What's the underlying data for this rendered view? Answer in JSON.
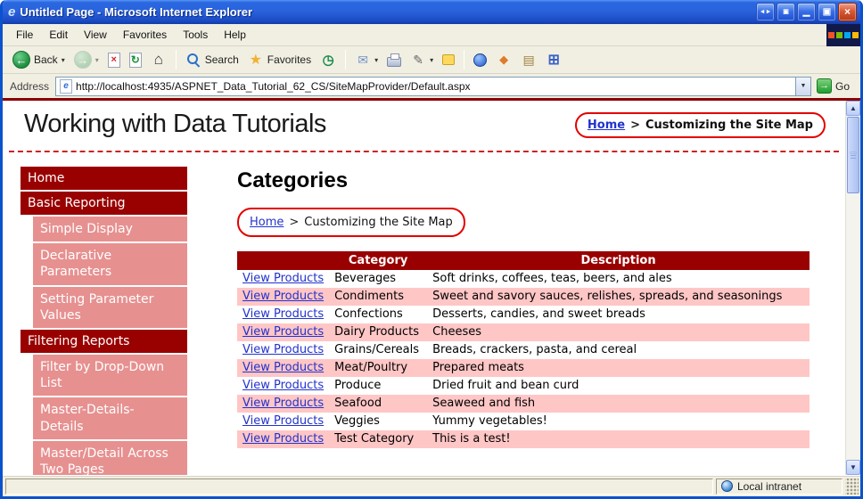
{
  "colors": {
    "accent_red": "#990000",
    "table_row_pink": "#ffc6c6",
    "sidebar_pink": "#e79090",
    "annotation_red": "#e30000",
    "link_blue": "#2233cc",
    "titlebar_blue": "#2a63dd"
  },
  "window": {
    "title": "Untitled Page - Microsoft Internet Explorer",
    "icon_glyph": "e",
    "controls": [
      {
        "name": "monitor-arrows-button",
        "glyph": "◄►",
        "cls": "aux"
      },
      {
        "name": "monitor-window-button",
        "glyph": "▣",
        "cls": "aux"
      },
      {
        "name": "minimize-button",
        "glyph": "▁",
        "cls": "blue"
      },
      {
        "name": "restore-button",
        "glyph": "▣",
        "cls": "blue"
      },
      {
        "name": "close-button",
        "glyph": "×",
        "cls": "close"
      }
    ]
  },
  "menu": {
    "items": [
      "File",
      "Edit",
      "View",
      "Favorites",
      "Tools",
      "Help"
    ]
  },
  "toolbar": {
    "dropdown_glyph": "▾",
    "items": [
      {
        "type": "button",
        "name": "back-button",
        "label": "Back",
        "icon": "back-icon",
        "glyph": "←",
        "dropdown": true
      },
      {
        "type": "button",
        "name": "forward-button",
        "icon": "forward-icon",
        "glyph": "→",
        "dropdown": true,
        "disabled": true
      },
      {
        "type": "button",
        "name": "stop-button",
        "icon": "stop-icon",
        "glyph": "×"
      },
      {
        "type": "button",
        "name": "refresh-button",
        "icon": "refresh-icon",
        "glyph": "↻"
      },
      {
        "type": "button",
        "name": "home-button",
        "icon": "home-icon",
        "glyph": "⌂"
      },
      {
        "type": "separator"
      },
      {
        "type": "button",
        "name": "search-button",
        "label": "Search",
        "icon": "search-icon",
        "glyph": ""
      },
      {
        "type": "button",
        "name": "favorites-button",
        "label": "Favorites",
        "icon": "favorites-icon",
        "glyph": "★"
      },
      {
        "type": "button",
        "name": "history-button",
        "icon": "history-icon",
        "glyph": "◷"
      },
      {
        "type": "separator"
      },
      {
        "type": "button",
        "name": "mail-button",
        "icon": "mail-icon",
        "glyph": "✉",
        "dropdown": true
      },
      {
        "type": "button",
        "name": "print-button",
        "icon": "print-icon",
        "glyph": ""
      },
      {
        "type": "button",
        "name": "edit-button",
        "icon": "edit-icon",
        "glyph": "✎",
        "dropdown": true
      },
      {
        "type": "button",
        "name": "discuss-button",
        "icon": "discuss-icon",
        "glyph": ""
      },
      {
        "type": "separator"
      },
      {
        "type": "button",
        "name": "messenger-button",
        "icon": "messenger-icon",
        "glyph": ""
      },
      {
        "type": "button",
        "name": "research-button",
        "icon": "research-icon",
        "glyph": "◆"
      },
      {
        "type": "button",
        "name": "folders-button",
        "icon": "folders-icon",
        "glyph": "▤"
      },
      {
        "type": "button",
        "name": "tiles-button",
        "icon": "tiles-icon",
        "glyph": "⊞"
      }
    ]
  },
  "address": {
    "label": "Address",
    "page_icon_glyph": "e",
    "value": "http://localhost:4935/ASPNET_Data_Tutorial_62_CS/SiteMapProvider/Default.aspx",
    "dropdown_glyph": "▼",
    "go_icon_glyph": "→",
    "go_label": "Go"
  },
  "scrollbar": {
    "up_glyph": "▲",
    "down_glyph": "▼"
  },
  "status": {
    "zone": "Local intranet"
  },
  "page": {
    "title": "Working with Data Tutorials",
    "breadcrumb_top": {
      "home": "Home",
      "separator": ">",
      "current": "Customizing the Site Map"
    },
    "heading": "Categories",
    "breadcrumb_main": {
      "home": "Home",
      "separator": ">",
      "current": "Customizing the Site Map"
    },
    "sidebar": [
      {
        "label": "Home",
        "type": "header"
      },
      {
        "label": "Basic Reporting",
        "type": "header"
      },
      {
        "label": "Simple Display",
        "type": "item"
      },
      {
        "label": "Declarative Parameters",
        "type": "item"
      },
      {
        "label": "Setting Parameter Values",
        "type": "item"
      },
      {
        "label": "Filtering Reports",
        "type": "header"
      },
      {
        "label": "Filter by Drop-Down List",
        "type": "item"
      },
      {
        "label": "Master-Details-Details",
        "type": "item"
      },
      {
        "label": "Master/Detail Across Two Pages",
        "type": "item"
      },
      {
        "label": "",
        "type": "item"
      }
    ],
    "table": {
      "link_label": "View Products",
      "headers": [
        "",
        "Category",
        "Description"
      ],
      "rows": [
        {
          "category": "Beverages",
          "description": "Soft drinks, coffees, teas, beers, and ales"
        },
        {
          "category": "Condiments",
          "description": "Sweet and savory sauces, relishes, spreads, and seasonings"
        },
        {
          "category": "Confections",
          "description": "Desserts, candies, and sweet breads"
        },
        {
          "category": "Dairy Products",
          "description": "Cheeses"
        },
        {
          "category": "Grains/Cereals",
          "description": "Breads, crackers, pasta, and cereal"
        },
        {
          "category": "Meat/Poultry",
          "description": "Prepared meats"
        },
        {
          "category": "Produce",
          "description": "Dried fruit and bean curd"
        },
        {
          "category": "Seafood",
          "description": "Seaweed and fish"
        },
        {
          "category": "Veggies",
          "description": "Yummy vegetables!"
        },
        {
          "category": "Test Category",
          "description": "This is a test!"
        }
      ]
    }
  }
}
